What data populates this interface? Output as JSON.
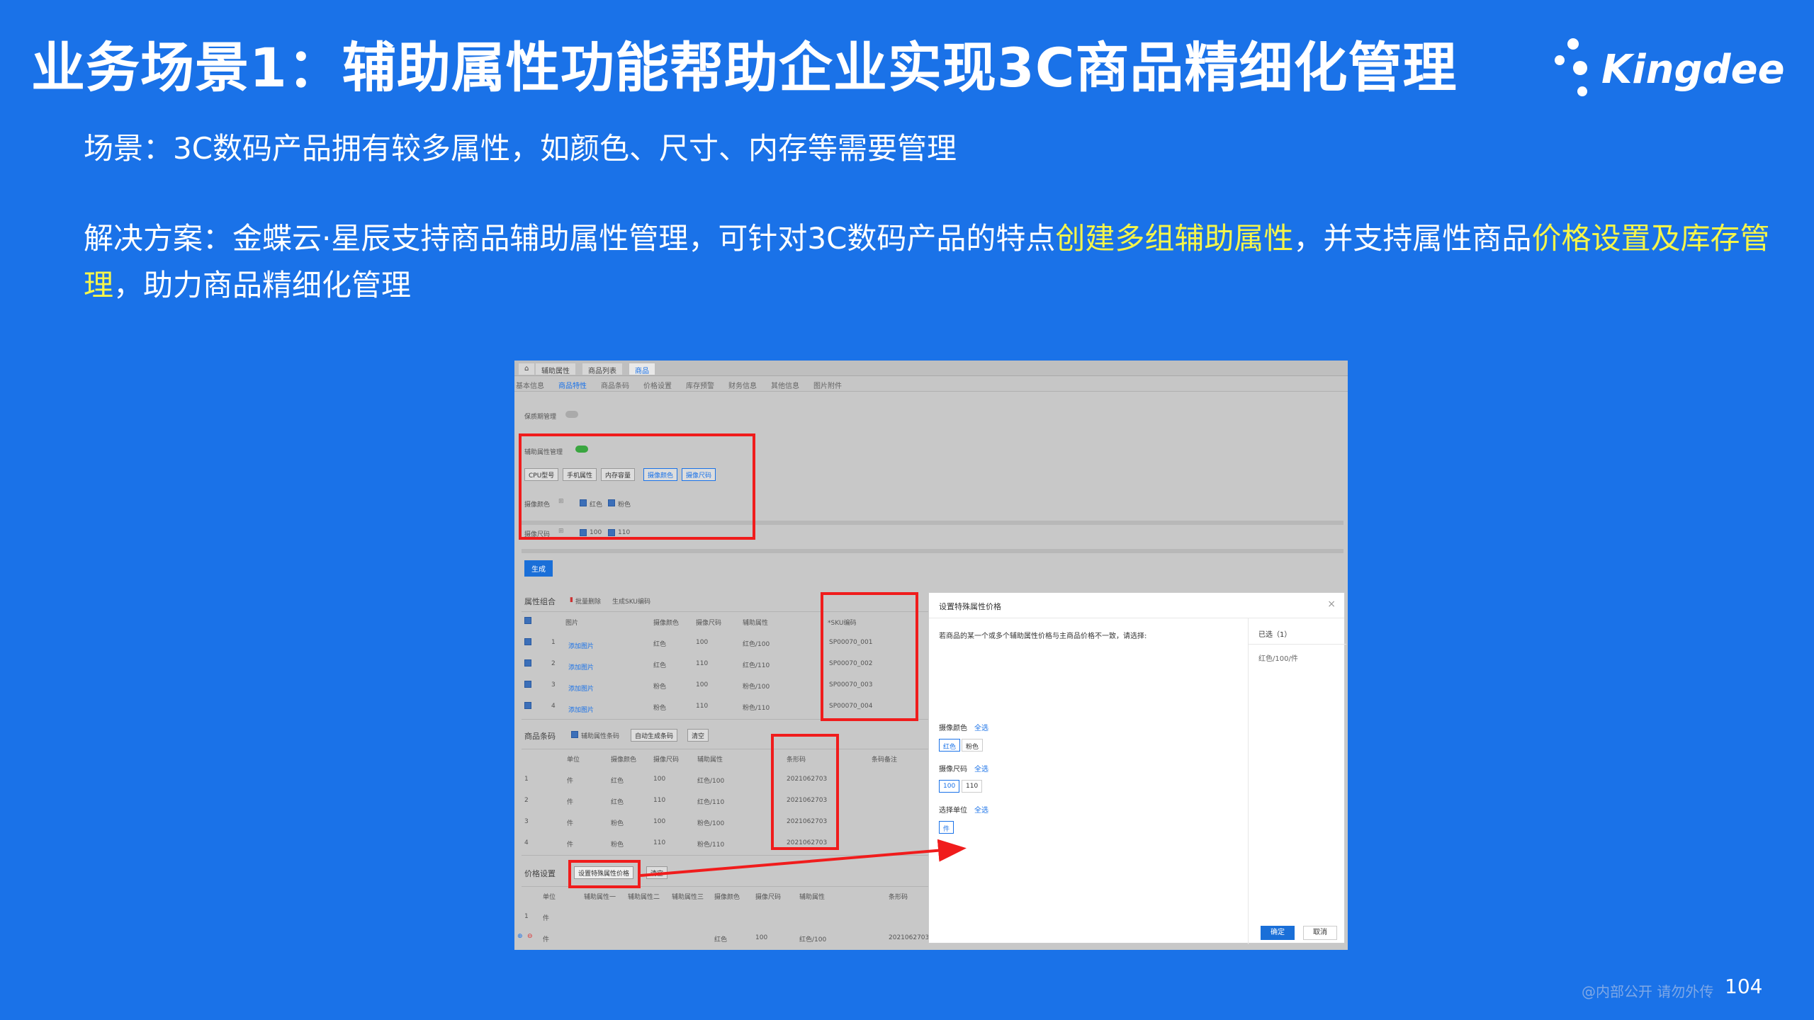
{
  "title": "业务场景1：辅助属性功能帮助企业实现3C商品精细化管理",
  "logo": {
    "text": "Kingdee"
  },
  "scene": "场景：3C数码产品拥有较多属性，如颜色、尺寸、内存等需要管理",
  "solution": {
    "part1": "解决方案：金蝶云·星辰支持商品辅助属性管理，可针对3C数码产品的特点",
    "hl1": "创建多组辅助属性",
    "part2": "，并支持属性商品",
    "hl2": "价格设置及库存管理",
    "part3": "，助力商品精细化管理"
  },
  "screenshot": {
    "tabs": [
      "辅助属性",
      "商品列表",
      "商品"
    ],
    "steps": [
      "基本信息",
      "商品特性",
      "商品条码",
      "价格设置",
      "库存预警",
      "财务信息",
      "其他信息",
      "图片附件"
    ],
    "toggle_label": "保质期管理",
    "aux_label": "辅助属性管理",
    "aux_buttons": [
      "CPU型号",
      "手机属性",
      "内存容量",
      "摄像颜色",
      "摄像尺码"
    ],
    "color_label": "摄像颜色",
    "color_values": [
      "红色",
      "粉色"
    ],
    "size_label": "摄像尺码",
    "size_values": [
      "100",
      "110"
    ],
    "generate_button": "生成",
    "combo": {
      "header": "属性组合",
      "actions": [
        "批量删除",
        "生成SKU编码"
      ],
      "columns": [
        "图片",
        "摄像颜色",
        "摄像尺码",
        "辅助属性",
        "*SKU编码"
      ],
      "rows": [
        [
          "1",
          "添加图片",
          "红色",
          "100",
          "红色/100",
          "SP00070_001"
        ],
        [
          "2",
          "添加图片",
          "红色",
          "110",
          "红色/110",
          "SP00070_002"
        ],
        [
          "3",
          "添加图片",
          "粉色",
          "100",
          "粉色/100",
          "SP00070_003"
        ],
        [
          "4",
          "添加图片",
          "粉色",
          "110",
          "粉色/110",
          "SP00070_004"
        ]
      ]
    },
    "barcode": {
      "header": "商品条码",
      "check_label": "辅助属性条码",
      "actions": [
        "自动生成条码",
        "清空"
      ],
      "columns": [
        "单位",
        "摄像颜色",
        "摄像尺码",
        "辅助属性",
        "条形码",
        "条码备注"
      ],
      "rows": [
        [
          "1",
          "件",
          "红色",
          "100",
          "红色/100",
          "2021062703"
        ],
        [
          "2",
          "件",
          "红色",
          "110",
          "红色/110",
          "2021062703"
        ],
        [
          "3",
          "件",
          "粉色",
          "100",
          "粉色/100",
          "2021062703"
        ],
        [
          "4",
          "件",
          "粉色",
          "110",
          "粉色/110",
          "2021062703"
        ]
      ]
    },
    "price": {
      "header": "价格设置",
      "actions": [
        "设置特殊属性价格",
        "清空"
      ],
      "columns": [
        "单位",
        "辅助属性一",
        "辅助属性二",
        "辅助属性三",
        "摄像颜色",
        "摄像尺码",
        "辅助属性",
        "条形码"
      ],
      "rows": [
        [
          "1",
          "件",
          "",
          "",
          "",
          "",
          "",
          "",
          ""
        ],
        [
          "",
          "件",
          "",
          "",
          "",
          "红色",
          "100",
          "红色/100",
          "2021062703"
        ]
      ]
    },
    "dialog": {
      "title": "设置特殊属性价格",
      "close": "×",
      "desc": "若商品的某一个或多个辅助属性价格与主商品价格不一致，请选择:",
      "groups": [
        {
          "label": "摄像颜色",
          "all": "全选",
          "options": [
            "红色",
            "粉色"
          ]
        },
        {
          "label": "摄像尺码",
          "all": "全选",
          "options": [
            "100",
            "110"
          ]
        },
        {
          "label": "选择单位",
          "all": "全选",
          "options": [
            "件"
          ]
        }
      ],
      "selected_header": "已选（1）",
      "selected_item": "红色/100/件",
      "ok": "确定",
      "cancel": "取消"
    }
  },
  "footer": "@内部公开 请勿外传",
  "page_number": "104"
}
